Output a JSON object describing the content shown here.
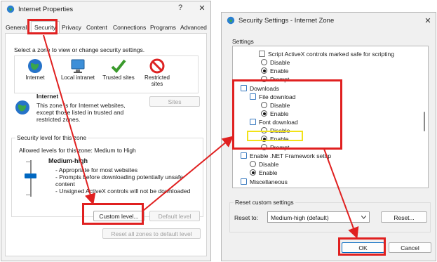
{
  "internet_properties": {
    "title": "Internet Properties",
    "title_buttons": {
      "help": "?",
      "close": "✕"
    },
    "tabs": [
      {
        "label": "General"
      },
      {
        "label": "Security",
        "active": true
      },
      {
        "label": "Privacy"
      },
      {
        "label": "Content"
      },
      {
        "label": "Connections"
      },
      {
        "label": "Programs"
      },
      {
        "label": "Advanced"
      }
    ],
    "zone_prompt": "Select a zone to view or change security settings.",
    "zones": [
      {
        "label": "Internet",
        "icon": "globe-icon"
      },
      {
        "label": "Local intranet",
        "icon": "monitor-icon"
      },
      {
        "label": "Trusted sites",
        "icon": "checkmark-icon"
      },
      {
        "label": "Restricted sites",
        "icon": "no-entry-icon"
      }
    ],
    "zone_info": {
      "heading": "Internet",
      "description_lines": [
        "This zone is for Internet websites,",
        "except those listed in trusted and",
        "restricted zones."
      ]
    },
    "sites_button": "Sites",
    "security_level": {
      "group_label": "Security level for this zone",
      "allowed_levels": "Allowed levels for this zone: Medium to High",
      "level_name": "Medium-high",
      "bullets": [
        "- Appropriate for most websites",
        "- Prompts before downloading potentially unsafe",
        "  content",
        "- Unsigned ActiveX controls will not be downloaded"
      ]
    },
    "buttons": {
      "custom_level": "Custom level...",
      "default_level": "Default level",
      "reset_all": "Reset all zones to default level"
    }
  },
  "security_settings": {
    "title": "Security Settings - Internet Zone",
    "close": "✕",
    "settings_label": "Settings",
    "items": [
      {
        "label": "Script ActiveX controls marked safe for scripting",
        "kind": "setting"
      },
      {
        "label": "Disable",
        "kind": "radio",
        "checked": false
      },
      {
        "label": "Enable",
        "kind": "radio",
        "checked": true
      },
      {
        "label": "Prompt",
        "kind": "radio",
        "checked": false
      },
      {
        "label": "Downloads",
        "kind": "category"
      },
      {
        "label": "File download",
        "kind": "setting"
      },
      {
        "label": "Disable",
        "kind": "radio",
        "checked": false
      },
      {
        "label": "Enable",
        "kind": "radio",
        "checked": true
      },
      {
        "label": "Font download",
        "kind": "setting"
      },
      {
        "label": "Disable",
        "kind": "radio",
        "checked": false
      },
      {
        "label": "Enable",
        "kind": "radio",
        "checked": true
      },
      {
        "label": "Prompt",
        "kind": "radio",
        "checked": false
      },
      {
        "label": "Enable .NET Framework setup",
        "kind": "setting"
      },
      {
        "label": "Disable",
        "kind": "radio",
        "checked": false
      },
      {
        "label": "Enable",
        "kind": "radio",
        "checked": true
      },
      {
        "label": "Miscellaneous",
        "kind": "category"
      }
    ],
    "reset": {
      "group_label": "Reset custom settings",
      "reset_to_label": "Reset to:",
      "selected_value": "Medium-high (default)",
      "reset_button": "Reset..."
    },
    "ok": "OK",
    "cancel": "Cancel"
  },
  "colors": {
    "highlight_red": "#e02020",
    "highlight_yellow": "#f2e218",
    "accent": "#0067c0"
  }
}
